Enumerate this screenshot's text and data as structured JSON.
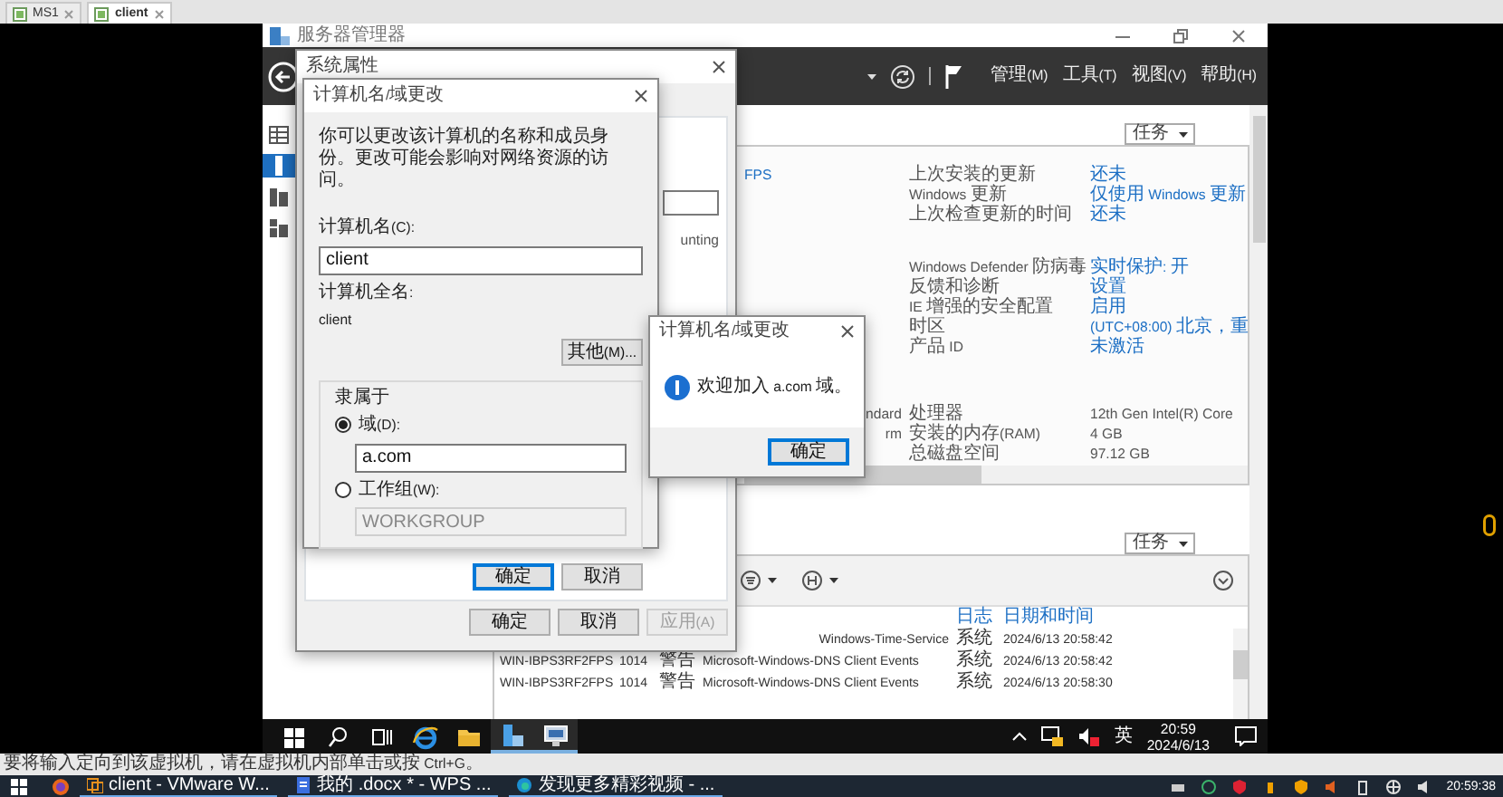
{
  "vm_tabs": [
    {
      "label": "MS1",
      "selected": false
    },
    {
      "label": "client",
      "selected": true
    }
  ],
  "server_manager": {
    "title": "服务器管理器",
    "menu": [
      "管理(M)",
      "工具(T)",
      "视图(V)",
      "帮助(H)"
    ],
    "nav": [
      {
        "kind": "dashboard",
        "selected": false
      },
      {
        "kind": "local",
        "selected": true
      },
      {
        "kind": "all",
        "selected": false
      },
      {
        "kind": "role",
        "selected": false
      }
    ],
    "properties": {
      "tasks": "任务",
      "server_fragment": "FPS",
      "groups": [
        [
          {
            "label": "上次安装的更新",
            "value": "还未",
            "kind": "link"
          },
          {
            "label": "Windows 更新",
            "value": "仅使用 Windows 更新",
            "kind": "link"
          },
          {
            "label": "上次检查更新的时间",
            "value": "还未",
            "kind": "link"
          }
        ],
        [
          {
            "label": "Windows Defender 防病毒",
            "value": "实时保护: 开",
            "kind": "link"
          },
          {
            "label": "反馈和诊断",
            "value": "设置",
            "kind": "link"
          },
          {
            "label": "IE 增强的安全配置",
            "value": "启用",
            "kind": "link"
          },
          {
            "label": "时区",
            "value": "(UTC+08:00) 北京，重",
            "kind": "link"
          },
          {
            "label": "产品 ID",
            "value": "未激活",
            "kind": "link"
          }
        ],
        [
          {
            "left": "ndard",
            "label": "处理器",
            "value": "12th Gen Intel(R) Core",
            "kind": "text"
          },
          {
            "left": "rm",
            "label": "安装的内存(RAM)",
            "value": "4 GB",
            "kind": "text"
          },
          {
            "label": "总磁盘空间",
            "value": "97.12 GB",
            "kind": "text"
          }
        ]
      ]
    },
    "events": {
      "tasks": "任务",
      "columns": [
        "日志",
        "日期和时间"
      ],
      "rows": [
        {
          "source": "Windows-Time-Service",
          "log": "系统",
          "time": "2024/6/13 20:58:42"
        },
        {
          "server": "WIN-IBPS3RF2FPS",
          "id": "1014",
          "level": "警告",
          "source": "Microsoft-Windows-DNS Client Events",
          "log": "系统",
          "time": "2024/6/13 20:58:42"
        },
        {
          "server": "WIN-IBPS3RF2FPS",
          "id": "1014",
          "level": "警告",
          "source": "Microsoft-Windows-DNS Client Events",
          "log": "系统",
          "time": "2024/6/13 20:58:30"
        }
      ]
    }
  },
  "system_properties": {
    "title": "系统属性",
    "fragment": "unting",
    "buttons": [
      {
        "label": "确定",
        "disabled": false
      },
      {
        "label": "取消",
        "disabled": false
      },
      {
        "label": "应用(A)",
        "disabled": true
      }
    ]
  },
  "computer_name_dialog": {
    "title": "计算机名/域更改",
    "intro": "你可以更改该计算机的名称和成员身份。更改可能会影响对网络资源的访问。",
    "name_label": "计算机名(C):",
    "name_value": "client",
    "full_name_label": "计算机全名:",
    "full_name": "client",
    "more_button": "其他(M)...",
    "member_of": {
      "label": "隶属于",
      "options": [
        {
          "label": "域(D):",
          "selected": true,
          "value": "a.com"
        },
        {
          "label": "工作组(W):",
          "selected": false,
          "value": "WORKGROUP"
        }
      ]
    },
    "buttons": [
      {
        "label": "确定",
        "default": true
      },
      {
        "label": "取消",
        "default": false
      }
    ]
  },
  "message_box": {
    "title": "计算机名/域更改",
    "message": "欢迎加入 a.com 域。",
    "button": "确定"
  },
  "guest_taskbar": {
    "apps": [
      {
        "kind": "start",
        "active": false
      },
      {
        "kind": "search",
        "active": false
      },
      {
        "kind": "task-view",
        "active": false
      },
      {
        "kind": "browser",
        "active": false
      },
      {
        "kind": "folder",
        "active": false
      },
      {
        "kind": "server-manager",
        "active": true
      },
      {
        "kind": "system",
        "active": true
      }
    ],
    "input_method": "英",
    "time": "20:59",
    "date": "2024/6/13"
  },
  "vmware_status": "要将输入定向到该虚拟机，请在虚拟机内部单击或按 Ctrl+G。",
  "host_taskbar": {
    "windows": [
      "client - VMware W...",
      "我的 .docx * - WPS ...",
      "发现更多精彩视频 - ..."
    ],
    "clock": "20:59:38"
  }
}
